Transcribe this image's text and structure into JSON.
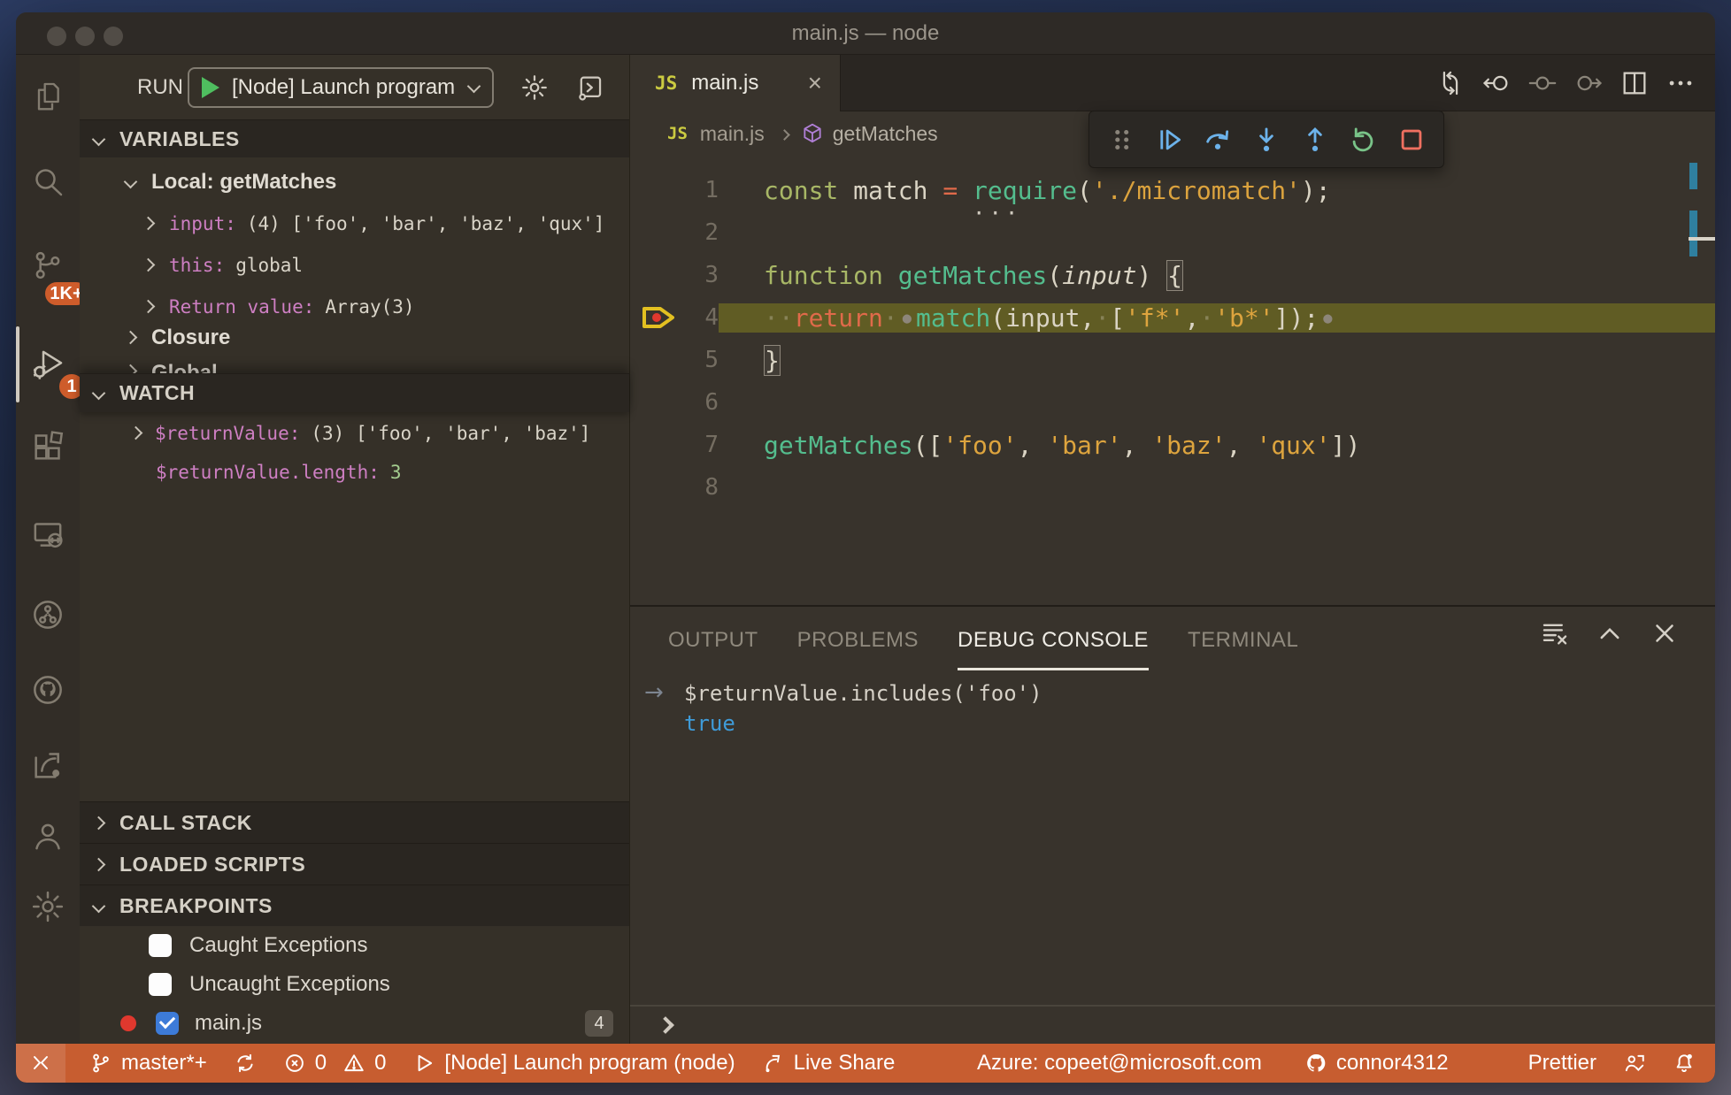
{
  "window": {
    "title": "main.js — node"
  },
  "activity_bar": {
    "scm_badge": "1K+",
    "debug_badge": "1",
    "icons": [
      "explorer-icon",
      "search-icon",
      "source-control-icon",
      "run-debug-icon",
      "extensions-icon",
      "remote-explorer-icon",
      "network-icon",
      "github-icon",
      "live-share-icon",
      "accounts-icon",
      "settings-gear-icon"
    ]
  },
  "sidebar": {
    "run_label": "RUN",
    "launch_config": "[Node] Launch program",
    "toolbar_icons": [
      "start-debug-icon",
      "gear-icon",
      "debug-console-icon"
    ],
    "variables_header": "VARIABLES",
    "scope_label": "Local: getMatches",
    "vars": {
      "input_name": "input:",
      "input_value": "(4) ['foo', 'bar', 'baz', 'qux']",
      "this_name": "this:",
      "this_value": "global",
      "return_name": "Return value:",
      "return_value": "Array(3)",
      "closure_label": "Closure",
      "global_label": "Global"
    },
    "watch_header": "WATCH",
    "watch": {
      "w1_name": "$returnValue:",
      "w1_value": "(3) ['foo', 'bar', 'baz']",
      "w2_name": "$returnValue.length:",
      "w2_value": "3"
    },
    "callstack_header": "CALL STACK",
    "loaded_scripts_header": "LOADED SCRIPTS",
    "breakpoints_header": "BREAKPOINTS",
    "breakpoints": {
      "bp1": "Caught Exceptions",
      "bp2": "Uncaught Exceptions",
      "bp3": "main.js",
      "bp3_badge": "4"
    }
  },
  "editor": {
    "tab_icon": "JS",
    "tab_label": "main.js",
    "breadcrumb_file": "main.js",
    "breadcrumb_symbol": "getMatches",
    "action_icons": [
      "open-changes-icon",
      "nav-back-icon",
      "nav-location-icon",
      "nav-forward-icon",
      "split-editor-icon",
      "more-actions-icon"
    ],
    "lines": [
      {
        "num": "1",
        "hint": true,
        "tokens": [
          [
            "kw",
            "const"
          ],
          [
            "pl",
            " match "
          ],
          [
            "op",
            "="
          ],
          [
            "pl",
            " "
          ],
          [
            "fn",
            "require"
          ],
          [
            "pl",
            "("
          ],
          [
            "str",
            "'./micromatch'"
          ],
          [
            "pl",
            ");"
          ]
        ]
      },
      {
        "num": "2",
        "tokens": []
      },
      {
        "num": "3",
        "tokens": [
          [
            "kw",
            "function"
          ],
          [
            "pl",
            " "
          ],
          [
            "fn",
            "getMatches"
          ],
          [
            "pl",
            "("
          ],
          [
            "param",
            "input"
          ],
          [
            "pl",
            ") "
          ],
          [
            "bm",
            "{"
          ]
        ]
      },
      {
        "num": "4",
        "current": true,
        "tokens": [
          [
            "ws",
            "··"
          ],
          [
            "ret",
            "return"
          ],
          [
            "ws",
            "·"
          ],
          [
            "bdot",
            "●"
          ],
          [
            "fn",
            "match"
          ],
          [
            "pl",
            "(input,"
          ],
          [
            "ws",
            "·"
          ],
          [
            "pl",
            "["
          ],
          [
            "str",
            "'f*'"
          ],
          [
            "pl",
            ","
          ],
          [
            "ws",
            "·"
          ],
          [
            "str",
            "'b*'"
          ],
          [
            "pl",
            "]);"
          ],
          [
            "bdot",
            "●"
          ]
        ]
      },
      {
        "num": "5",
        "tokens": [
          [
            "bm",
            "}"
          ]
        ]
      },
      {
        "num": "6",
        "tokens": []
      },
      {
        "num": "7",
        "tokens": [
          [
            "fn",
            "getMatches"
          ],
          [
            "pl",
            "(["
          ],
          [
            "str",
            "'foo'"
          ],
          [
            "pl",
            ", "
          ],
          [
            "str",
            "'bar'"
          ],
          [
            "pl",
            ", "
          ],
          [
            "str",
            "'baz'"
          ],
          [
            "pl",
            ", "
          ],
          [
            "str",
            "'qux'"
          ],
          [
            "pl",
            "])"
          ]
        ]
      },
      {
        "num": "8",
        "tokens": []
      }
    ]
  },
  "debug_toolbar": {
    "icons": [
      "drag-grip-icon",
      "continue-icon",
      "step-over-icon",
      "step-into-icon",
      "step-out-icon",
      "restart-icon",
      "stop-icon"
    ]
  },
  "panel": {
    "tabs": [
      "OUTPUT",
      "PROBLEMS",
      "DEBUG CONSOLE",
      "TERMINAL"
    ],
    "active_tab": "DEBUG CONSOLE",
    "action_icons": [
      "clear-console-icon",
      "maximize-panel-icon",
      "close-panel-icon"
    ],
    "console_echo": "$returnValue.includes('foo')",
    "console_result": "true"
  },
  "status_bar": {
    "branch": "master*+",
    "errors": "0",
    "warnings": "0",
    "launch": "[Node] Launch program (node)",
    "live_share": "Live Share",
    "azure_account": "Azure: copeet@microsoft.com",
    "github_user": "connor4312",
    "formatter": "Prettier",
    "colors": {
      "background": "#c75d30",
      "badge": "#ce5c2b"
    }
  }
}
